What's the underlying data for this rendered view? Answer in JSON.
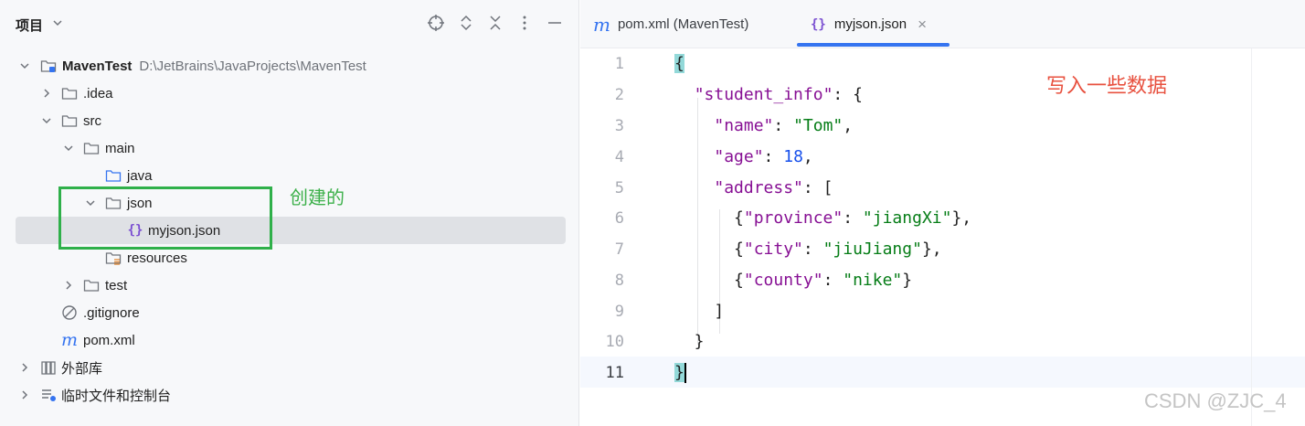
{
  "panel": {
    "title": "项目",
    "toolbar_icons": [
      "target-icon",
      "expand-icon",
      "collapse-icon",
      "more-icon",
      "minimize-icon"
    ]
  },
  "tree": [
    {
      "name": "MavenTest",
      "path": "D:\\JetBrains\\JavaProjects\\MavenTest",
      "icon": "module-folder-icon",
      "expanded": true,
      "bold": true
    },
    {
      "name": ".idea",
      "icon": "folder-icon",
      "expanded": false
    },
    {
      "name": "src",
      "icon": "folder-icon",
      "expanded": true
    },
    {
      "name": "main",
      "icon": "folder-icon",
      "expanded": true
    },
    {
      "name": "java",
      "icon": "source-folder-icon"
    },
    {
      "name": "json",
      "icon": "folder-icon",
      "expanded": true
    },
    {
      "name": "myjson.json",
      "icon": "json-file-icon",
      "selected": true
    },
    {
      "name": "resources",
      "icon": "resources-folder-icon"
    },
    {
      "name": "test",
      "icon": "folder-icon",
      "expanded": false
    },
    {
      "name": ".gitignore",
      "icon": "ignore-file-icon"
    },
    {
      "name": "pom.xml",
      "icon": "maven-icon"
    },
    {
      "name": "外部库",
      "icon": "library-icon",
      "expanded": false
    },
    {
      "name": "临时文件和控制台",
      "icon": "scratch-icon",
      "expanded": false
    }
  ],
  "annotations": {
    "created": "创建的",
    "write_data": "写入一些数据"
  },
  "tabs": [
    {
      "label": "pom.xml (MavenTest)",
      "icon": "maven-icon",
      "active": false
    },
    {
      "label": "myjson.json",
      "icon": "json-file-icon",
      "active": true,
      "close": "×"
    }
  ],
  "editor": {
    "line_numbers": [
      "1",
      "2",
      "3",
      "4",
      "5",
      "6",
      "7",
      "8",
      "9",
      "10",
      "11"
    ],
    "current_line": "11",
    "lines": [
      [
        {
          "t": "p",
          "v": "{"
        }
      ],
      [
        {
          "t": "p",
          "v": "  "
        },
        {
          "t": "k",
          "v": "\"student_info\""
        },
        {
          "t": "p",
          "v": ": {"
        }
      ],
      [
        {
          "t": "p",
          "v": "    "
        },
        {
          "t": "k",
          "v": "\"name\""
        },
        {
          "t": "p",
          "v": ": "
        },
        {
          "t": "s",
          "v": "\"Tom\""
        },
        {
          "t": "p",
          "v": ","
        }
      ],
      [
        {
          "t": "p",
          "v": "    "
        },
        {
          "t": "k",
          "v": "\"age\""
        },
        {
          "t": "p",
          "v": ": "
        },
        {
          "t": "n",
          "v": "18"
        },
        {
          "t": "p",
          "v": ","
        }
      ],
      [
        {
          "t": "p",
          "v": "    "
        },
        {
          "t": "k",
          "v": "\"address\""
        },
        {
          "t": "p",
          "v": ": ["
        }
      ],
      [
        {
          "t": "p",
          "v": "      {"
        },
        {
          "t": "k",
          "v": "\"province\""
        },
        {
          "t": "p",
          "v": ": "
        },
        {
          "t": "s",
          "v": "\"jiangXi\""
        },
        {
          "t": "p",
          "v": "},"
        }
      ],
      [
        {
          "t": "p",
          "v": "      {"
        },
        {
          "t": "k",
          "v": "\"city\""
        },
        {
          "t": "p",
          "v": ": "
        },
        {
          "t": "s",
          "v": "\"jiuJiang\""
        },
        {
          "t": "p",
          "v": "},"
        }
      ],
      [
        {
          "t": "p",
          "v": "      {"
        },
        {
          "t": "k",
          "v": "\"county\""
        },
        {
          "t": "p",
          "v": ": "
        },
        {
          "t": "s",
          "v": "\"nike\""
        },
        {
          "t": "p",
          "v": "}"
        }
      ],
      [
        {
          "t": "p",
          "v": "    ]"
        }
      ],
      [
        {
          "t": "p",
          "v": "  }"
        }
      ],
      [
        {
          "t": "p",
          "v": "}"
        }
      ]
    ]
  },
  "watermark": "CSDN @ZJC_4",
  "colors": {
    "accent": "#3574f0",
    "annotation_box": "#2fb04a",
    "annotation_red": "#e8513f",
    "json_key": "#871094",
    "json_string": "#067d17",
    "json_number": "#1750eb"
  }
}
